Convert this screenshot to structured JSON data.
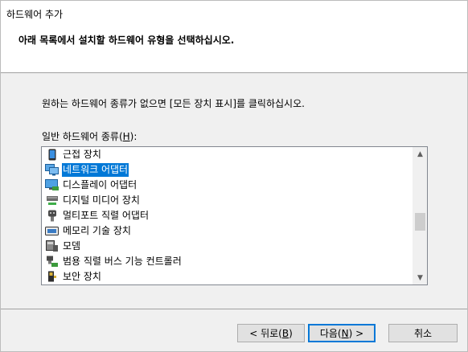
{
  "window": {
    "title": "하드웨어 추가"
  },
  "header": {
    "subtitle": "아래 목록에서 설치할 하드웨어 유형을 선택하십시오."
  },
  "instruction": "원하는 하드웨어 종류가 없으면 [모든 장치 표시]를 클릭하십시오.",
  "list": {
    "label_prefix": "일반 하드웨어 종류(",
    "label_key": "H",
    "label_suffix": "):",
    "items": [
      {
        "label": "근접 장치",
        "icon": "proximity-device-icon"
      },
      {
        "label": "네트워크 어댑터",
        "icon": "network-adapter-icon",
        "selected": true
      },
      {
        "label": "디스플레이 어댑터",
        "icon": "display-adapter-icon"
      },
      {
        "label": "디지털 미디어 장치",
        "icon": "digital-media-device-icon"
      },
      {
        "label": "멀티포트 직렬 어댑터",
        "icon": "multiport-serial-adapter-icon"
      },
      {
        "label": "메모리 기술 장치",
        "icon": "memory-technology-device-icon"
      },
      {
        "label": "모뎀",
        "icon": "modem-icon"
      },
      {
        "label": "범용 직렬 버스 기능 컨트롤러",
        "icon": "usb-function-controller-icon"
      },
      {
        "label": "보안 장치",
        "icon": "security-device-icon"
      }
    ]
  },
  "buttons": {
    "back": {
      "prefix": "< 뒤로(",
      "key": "B",
      "suffix": ")"
    },
    "next": {
      "prefix": "다음(",
      "key": "N",
      "suffix": ") >"
    },
    "cancel": "취소"
  },
  "colors": {
    "selection": "#0078d7",
    "default_button_border": "#0078d7"
  }
}
